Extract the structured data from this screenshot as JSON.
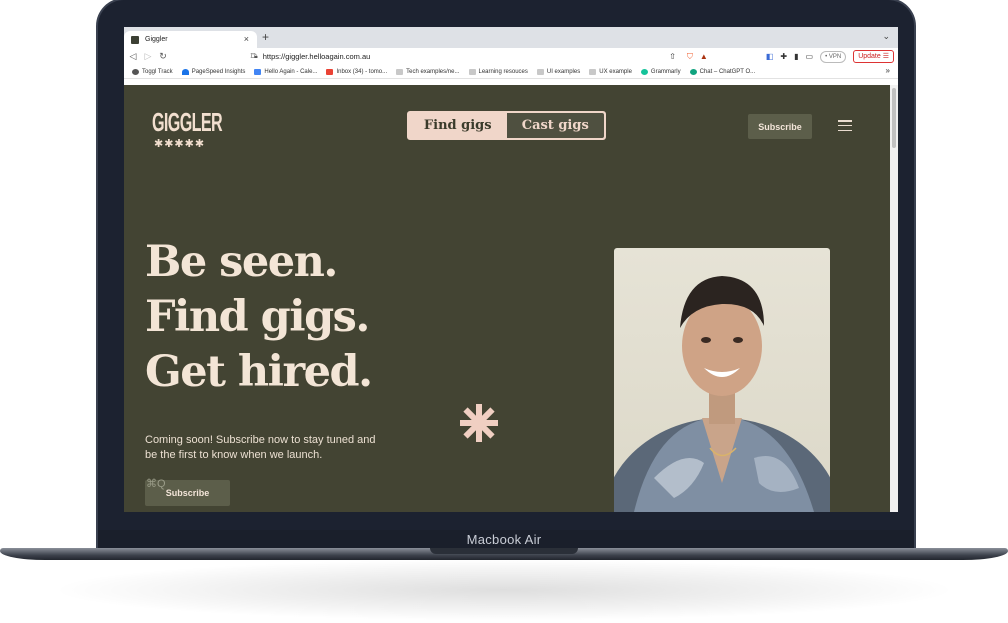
{
  "device": {
    "label": "Macbook Air"
  },
  "browser": {
    "tab_title": "Giggler",
    "new_tab": "+",
    "tab_close": "×",
    "url": "https://giggler.helloagain.com.au",
    "vpn_label": "• VPN",
    "update_label": "Update",
    "bookmarks": [
      "Toggl Track",
      "PageSpeed Insights",
      "Hello Again - Cale...",
      "Inbox (34) - tomo...",
      "Tech examples/ne...",
      "Learning resouces",
      "UI examples",
      "UX example",
      "Grammarly",
      "Chat – ChatGPT O..."
    ],
    "bookmarks_more": "»"
  },
  "site": {
    "logo_text": "GIGGLER",
    "logo_stars": "✱✱✱✱✱",
    "toggle": {
      "find": "Find gigs",
      "cast": "Cast gigs"
    },
    "subscribe_top": "Subscribe",
    "hero_lines": [
      "Be seen.",
      "Find gigs.",
      "Get hired."
    ],
    "sub_text": "Coming soon! Subscribe now to stay tuned and be the first to know when we launch.",
    "subscribe_bottom": "Subscribe",
    "overlay_text": "⌘Q"
  },
  "colors": {
    "page_bg": "#434433",
    "accent_pink": "#f0d6c9",
    "cream_text": "#f3e5d6",
    "button_bg": "#5c5e4a"
  },
  "icons": [
    "back-icon",
    "forward-icon",
    "reload-icon",
    "bookmark-icon",
    "lock-icon",
    "share-icon",
    "brave-shield-icon",
    "brave-rewards-icon",
    "extensions-icon",
    "sidebar-icon",
    "wallet-icon",
    "menu-icon",
    "asterisk-icon"
  ]
}
